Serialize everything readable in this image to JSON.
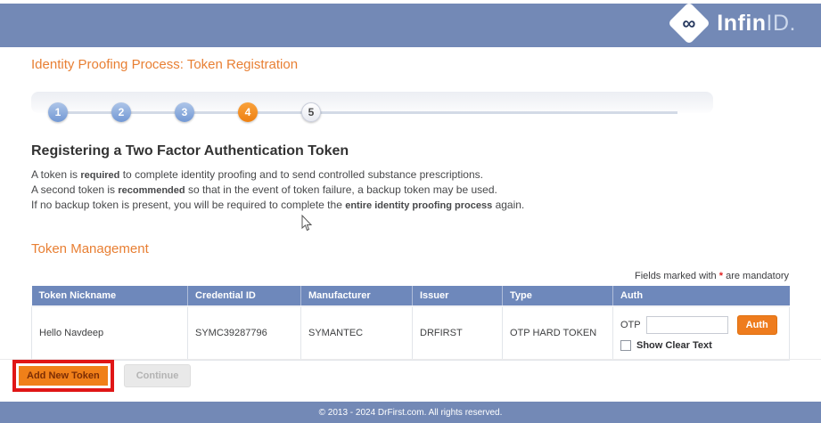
{
  "brand": {
    "infinity_glyph": "∞",
    "name_bold": "Infin",
    "name_light": "ID."
  },
  "page": {
    "title": "Identity Proofing Process: Token Registration"
  },
  "stepper": {
    "steps": [
      {
        "label": "1",
        "state": "done"
      },
      {
        "label": "2",
        "state": "done"
      },
      {
        "label": "3",
        "state": "done"
      },
      {
        "label": "4",
        "state": "active"
      },
      {
        "label": "5",
        "state": "todo"
      }
    ]
  },
  "section": {
    "heading": "Registering a Two Factor Authentication Token",
    "lines": [
      {
        "pre": "A token is ",
        "bold": "required",
        "post": " to complete identity proofing and to send controlled substance prescriptions."
      },
      {
        "pre": "A second token is ",
        "bold": "recommended",
        "post": " so that in the event of token failure, a backup token may be used."
      },
      {
        "pre": "If no backup token is present, you will be required to complete the ",
        "bold": "entire identity proofing process",
        "post": " again."
      }
    ]
  },
  "token_management": {
    "heading": "Token Management",
    "mandatory_note": {
      "pre": "Fields marked with ",
      "star": "*",
      "post": " are mandatory"
    }
  },
  "table": {
    "headers": [
      "Token Nickname",
      "Credential ID",
      "Manufacturer",
      "Issuer",
      "Type",
      "Auth"
    ],
    "row": {
      "nickname": "Hello Navdeep",
      "credential_id": "SYMC39287796",
      "manufacturer": "SYMANTEC",
      "issuer": "DRFIRST",
      "type": "OTP HARD TOKEN",
      "auth": {
        "otp_label": "OTP",
        "otp_value": "",
        "auth_button": "Auth",
        "show_clear_text": "Show Clear Text"
      }
    }
  },
  "actions": {
    "add_new_token": "Add New Token",
    "continue": "Continue"
  },
  "footer": {
    "copyright": "© 2013 - 2024 DrFirst.com. All rights reserved."
  },
  "colors": {
    "bar_blue": "#7389b6",
    "accent_orange": "#e87f33",
    "table_header_blue": "#6e88bb",
    "button_orange": "#ee7c1e",
    "annotation_red": "#e01616",
    "mandatory_star_red": "#e02020"
  }
}
